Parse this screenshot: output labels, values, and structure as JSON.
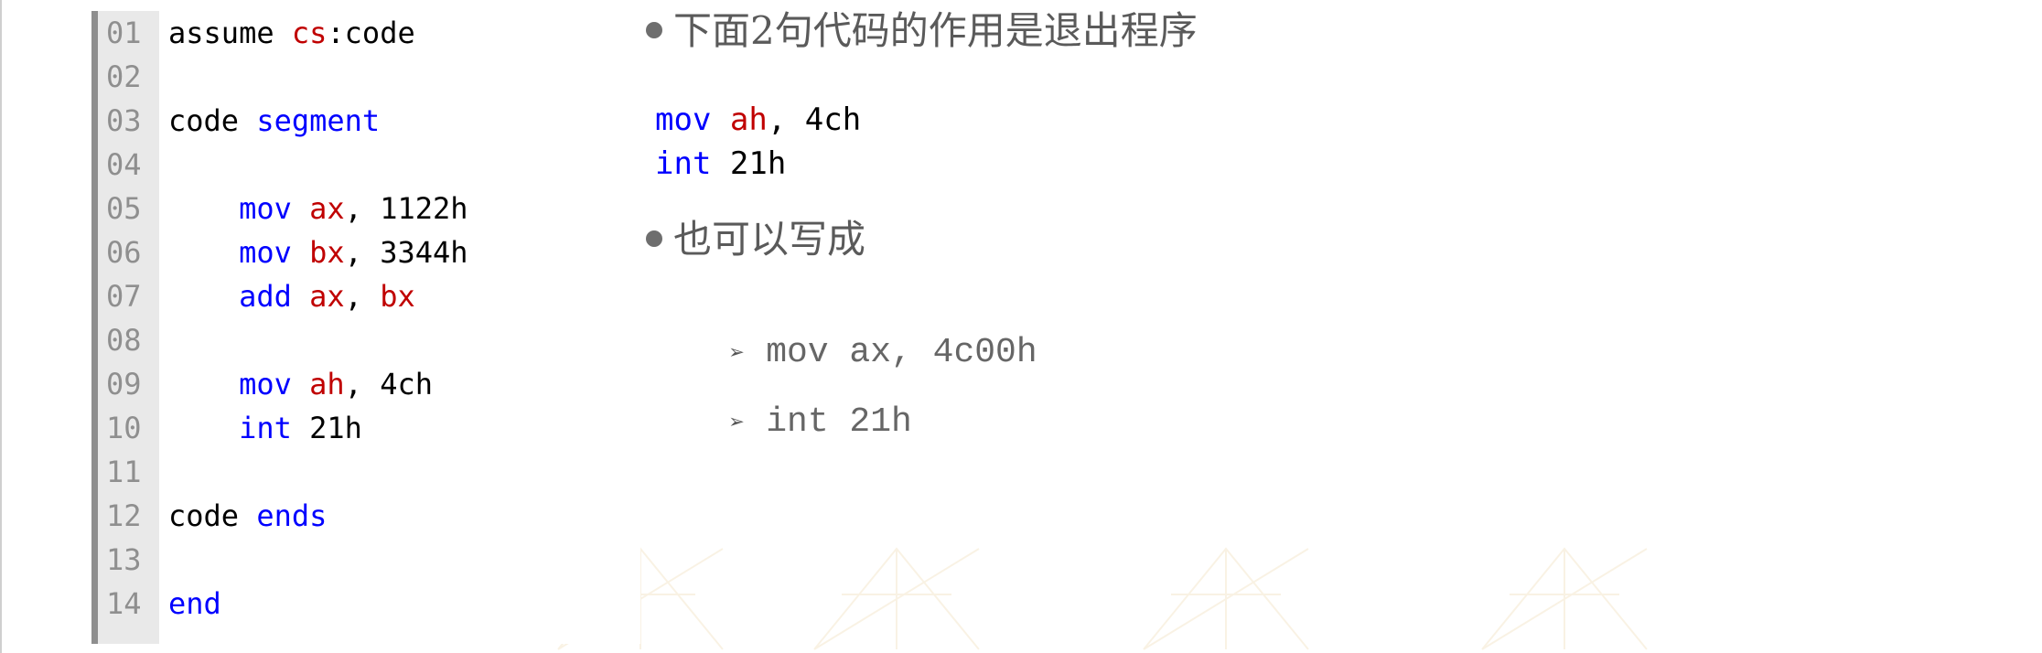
{
  "listing": {
    "lines": [
      {
        "no": "01",
        "parts": [
          {
            "t": "assume ",
            "k": "plain"
          },
          {
            "t": "cs",
            "k": "reg"
          },
          {
            "t": ":code",
            "k": "plain"
          }
        ]
      },
      {
        "no": "02",
        "parts": []
      },
      {
        "no": "03",
        "parts": [
          {
            "t": "code ",
            "k": "plain"
          },
          {
            "t": "segment",
            "k": "kw"
          }
        ]
      },
      {
        "no": "04",
        "parts": []
      },
      {
        "no": "05",
        "parts": [
          {
            "t": "    ",
            "k": "plain"
          },
          {
            "t": "mov",
            "k": "kw"
          },
          {
            "t": " ",
            "k": "plain"
          },
          {
            "t": "ax",
            "k": "reg"
          },
          {
            "t": ", 1122h",
            "k": "plain"
          }
        ]
      },
      {
        "no": "06",
        "parts": [
          {
            "t": "    ",
            "k": "plain"
          },
          {
            "t": "mov",
            "k": "kw"
          },
          {
            "t": " ",
            "k": "plain"
          },
          {
            "t": "bx",
            "k": "reg"
          },
          {
            "t": ", 3344h",
            "k": "plain"
          }
        ]
      },
      {
        "no": "07",
        "parts": [
          {
            "t": "    ",
            "k": "plain"
          },
          {
            "t": "add",
            "k": "kw"
          },
          {
            "t": " ",
            "k": "plain"
          },
          {
            "t": "ax",
            "k": "reg"
          },
          {
            "t": ", ",
            "k": "plain"
          },
          {
            "t": "bx",
            "k": "reg"
          }
        ]
      },
      {
        "no": "08",
        "parts": []
      },
      {
        "no": "09",
        "parts": [
          {
            "t": "    ",
            "k": "plain"
          },
          {
            "t": "mov",
            "k": "kw"
          },
          {
            "t": " ",
            "k": "plain"
          },
          {
            "t": "ah",
            "k": "reg"
          },
          {
            "t": ", 4ch",
            "k": "plain"
          }
        ]
      },
      {
        "no": "10",
        "parts": [
          {
            "t": "    ",
            "k": "plain"
          },
          {
            "t": "int",
            "k": "kw"
          },
          {
            "t": " 21h",
            "k": "plain"
          }
        ]
      },
      {
        "no": "11",
        "parts": []
      },
      {
        "no": "12",
        "parts": [
          {
            "t": "code ",
            "k": "plain"
          },
          {
            "t": "ends",
            "k": "kw"
          }
        ]
      },
      {
        "no": "13",
        "parts": []
      },
      {
        "no": "14",
        "parts": [
          {
            "t": "end",
            "k": "kw"
          }
        ]
      }
    ]
  },
  "notes": {
    "bullet1": "下面2句代码的作用是退出程序",
    "snippet": [
      [
        {
          "t": "mov",
          "k": "kw"
        },
        {
          "t": " ",
          "k": "plain"
        },
        {
          "t": "ah",
          "k": "reg"
        },
        {
          "t": ", 4ch",
          "k": "plain"
        }
      ],
      [
        {
          "t": "int",
          "k": "kw"
        },
        {
          "t": " 21h",
          "k": "plain"
        }
      ]
    ],
    "bullet2": "也可以写成",
    "sub1": "mov ax, 4c00h",
    "sub2": "int 21h"
  },
  "colors": {
    "keyword": "#0000ff",
    "register": "#c00000",
    "plain": "#000000",
    "gutter": "#e9e9e9"
  }
}
